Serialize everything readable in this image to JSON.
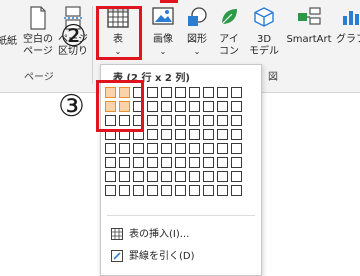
{
  "ribbon": {
    "buttons": [
      {
        "id": "cover",
        "label": "紙紙"
      },
      {
        "id": "blank",
        "label": "空白の\nページ"
      },
      {
        "id": "break",
        "label": "ページ\n区切り"
      },
      {
        "id": "table",
        "label": "表"
      },
      {
        "id": "image",
        "label": "画像"
      },
      {
        "id": "shape",
        "label": "図形"
      },
      {
        "id": "icon",
        "label": "アイ\nコン"
      },
      {
        "id": "model3d",
        "label": "3D\nモデル"
      },
      {
        "id": "smartart",
        "label": "SmartArt"
      },
      {
        "id": "graph",
        "label": "グラフ"
      }
    ],
    "groups": {
      "page": "ページ",
      "figure": "図"
    }
  },
  "callouts": {
    "step2": "②",
    "step3": "③"
  },
  "dropdown": {
    "title": "表 (2 行 x 2 列)",
    "grid": {
      "cols": 10,
      "rows": 8,
      "selected_cols": 2,
      "selected_rows": 2
    },
    "items": [
      {
        "label": "表の挿入(I)...",
        "icon": "table-icon"
      },
      {
        "label": "罫線を引く(D)",
        "icon": "pencil-icon"
      }
    ]
  },
  "colors": {
    "highlight": "#e0141e",
    "selected_cell": "#fbd3ab",
    "selected_border": "#f28c28"
  }
}
